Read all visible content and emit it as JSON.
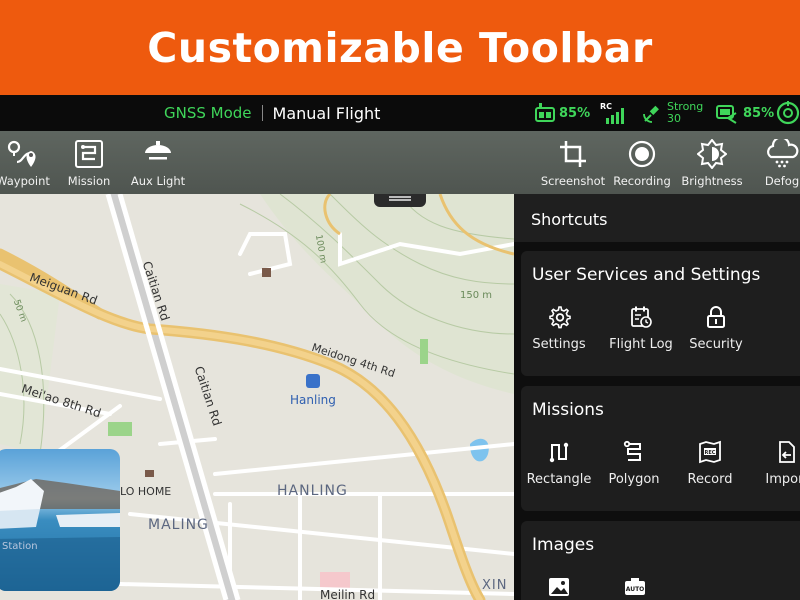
{
  "banner": {
    "title": "Customizable Toolbar"
  },
  "statusbar": {
    "mode": "GNSS Mode",
    "flight_mode": "Manual Flight",
    "rc_battery": "85%",
    "rc_label": "RC",
    "gps_strength": "Strong",
    "gps_count": "30",
    "aircraft_battery": "85%",
    "status_color": "#3fd65a"
  },
  "toolbar": {
    "items": [
      {
        "label": "Waypoint",
        "icon": "waypoint-icon"
      },
      {
        "label": "Mission",
        "icon": "mission-icon"
      },
      {
        "label": "Aux Light",
        "icon": "aux-light-icon"
      },
      {
        "label": "Screenshot",
        "icon": "screenshot-icon"
      },
      {
        "label": "Recording",
        "icon": "recording-icon"
      },
      {
        "label": "Brightness",
        "icon": "brightness-icon"
      },
      {
        "label": "Defog",
        "icon": "defog-icon"
      }
    ]
  },
  "map": {
    "roads": [
      "Meiguan Rd",
      "Caitian Rd",
      "Caitian Rd",
      "Meidong 4th Rd",
      "Mei'ao 8th Rd",
      "Meilin Rd"
    ],
    "places": [
      "Hanling",
      "HANLING",
      "MALING",
      "LO HOME",
      "XIN"
    ],
    "contours": [
      "100 m",
      "150 m",
      "50 m"
    ],
    "thumbnail_caption": "Station"
  },
  "panel": {
    "title": "Shortcuts",
    "sections": [
      {
        "title": "User Services and Settings",
        "items": [
          {
            "label": "Settings",
            "icon": "gear-icon"
          },
          {
            "label": "Flight Log",
            "icon": "flight-log-icon"
          },
          {
            "label": "Security",
            "icon": "lock-icon"
          }
        ]
      },
      {
        "title": "Missions",
        "items": [
          {
            "label": "Rectangle",
            "icon": "rectangle-mission-icon"
          },
          {
            "label": "Polygon",
            "icon": "polygon-mission-icon"
          },
          {
            "label": "Record",
            "icon": "record-icon"
          },
          {
            "label": "Import",
            "icon": "import-icon"
          }
        ]
      },
      {
        "title": "Images",
        "items": [
          {
            "label": "",
            "icon": "image-icon"
          },
          {
            "label": "AUTO",
            "icon": "auto-mode-icon"
          }
        ]
      }
    ]
  }
}
